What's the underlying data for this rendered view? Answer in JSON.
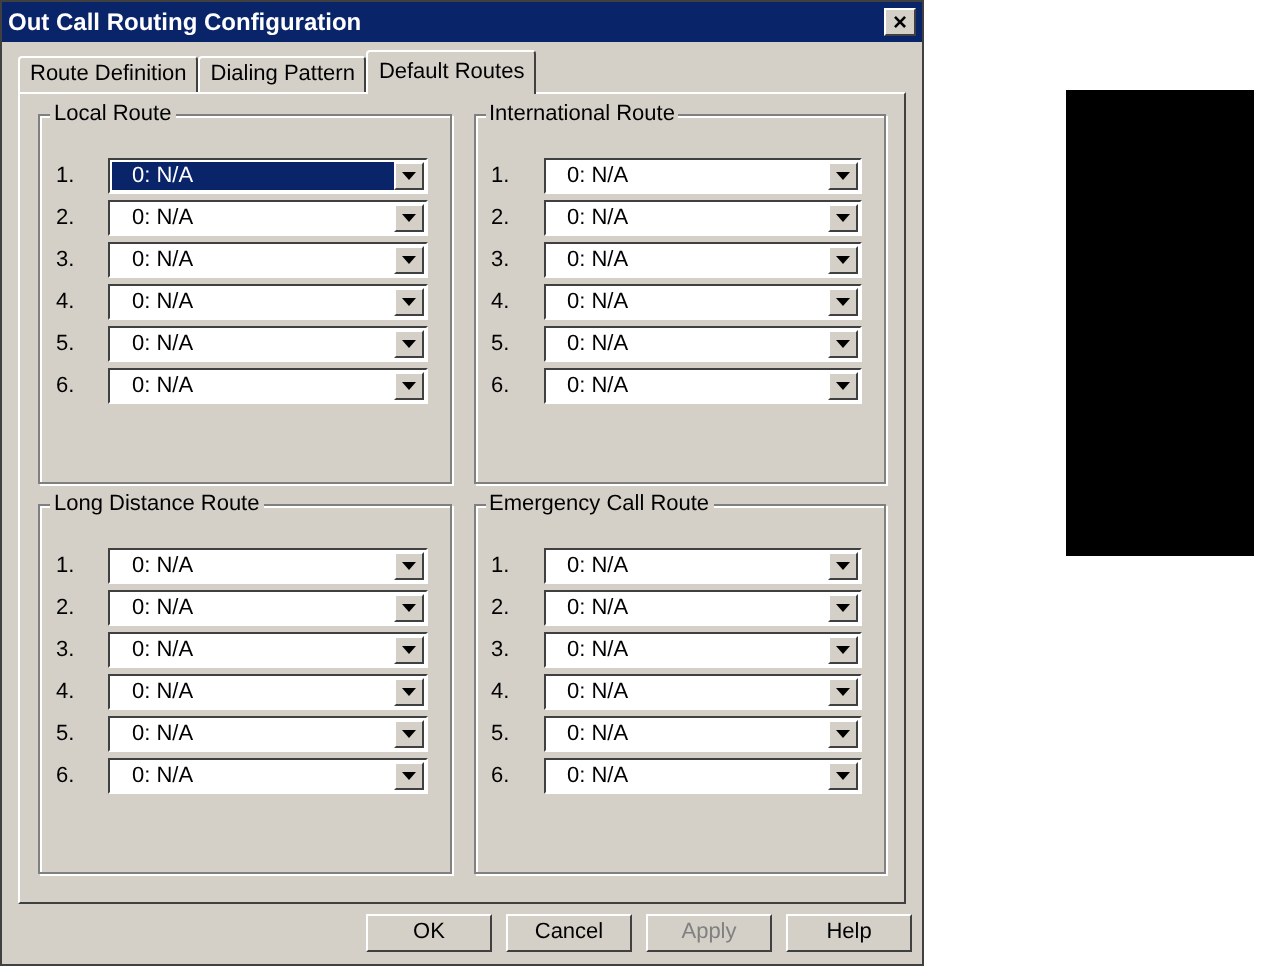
{
  "window": {
    "title": "Out Call Routing Configuration",
    "close": "×"
  },
  "tabs": [
    {
      "label": "Route Definition",
      "selected": false
    },
    {
      "label": "Dialing Pattern",
      "selected": false
    },
    {
      "label": "Default Routes",
      "selected": true
    }
  ],
  "groups": [
    {
      "title": "Local Route",
      "routes": [
        {
          "label": "1.",
          "value": "0: N/A",
          "focused": true
        },
        {
          "label": "2.",
          "value": "0: N/A",
          "focused": false
        },
        {
          "label": "3.",
          "value": "0: N/A",
          "focused": false
        },
        {
          "label": "4.",
          "value": "0: N/A",
          "focused": false
        },
        {
          "label": "5.",
          "value": "0: N/A",
          "focused": false
        },
        {
          "label": "6.",
          "value": "0: N/A",
          "focused": false
        }
      ]
    },
    {
      "title": "International Route",
      "routes": [
        {
          "label": "1.",
          "value": "0: N/A",
          "focused": false
        },
        {
          "label": "2.",
          "value": "0: N/A",
          "focused": false
        },
        {
          "label": "3.",
          "value": "0: N/A",
          "focused": false
        },
        {
          "label": "4.",
          "value": "0: N/A",
          "focused": false
        },
        {
          "label": "5.",
          "value": "0: N/A",
          "focused": false
        },
        {
          "label": "6.",
          "value": "0: N/A",
          "focused": false
        }
      ]
    },
    {
      "title": "Long Distance Route",
      "routes": [
        {
          "label": "1.",
          "value": "0: N/A",
          "focused": false
        },
        {
          "label": "2.",
          "value": "0: N/A",
          "focused": false
        },
        {
          "label": "3.",
          "value": "0: N/A",
          "focused": false
        },
        {
          "label": "4.",
          "value": "0: N/A",
          "focused": false
        },
        {
          "label": "5.",
          "value": "0: N/A",
          "focused": false
        },
        {
          "label": "6.",
          "value": "0: N/A",
          "focused": false
        }
      ]
    },
    {
      "title": "Emergency Call Route",
      "routes": [
        {
          "label": "1.",
          "value": "0: N/A",
          "focused": false
        },
        {
          "label": "2.",
          "value": "0: N/A",
          "focused": false
        },
        {
          "label": "3.",
          "value": "0: N/A",
          "focused": false
        },
        {
          "label": "4.",
          "value": "0: N/A",
          "focused": false
        },
        {
          "label": "5.",
          "value": "0: N/A",
          "focused": false
        },
        {
          "label": "6.",
          "value": "0: N/A",
          "focused": false
        }
      ]
    }
  ],
  "buttons": [
    {
      "label": "OK",
      "disabled": false
    },
    {
      "label": "Cancel",
      "disabled": false
    },
    {
      "label": "Apply",
      "disabled": true
    },
    {
      "label": "Help",
      "disabled": false
    }
  ]
}
